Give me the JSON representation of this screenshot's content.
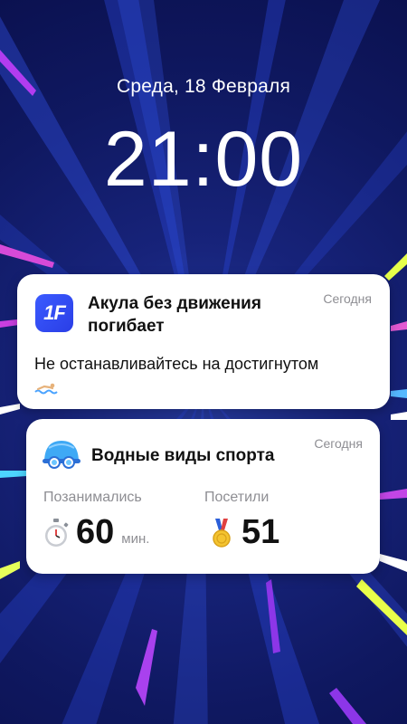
{
  "lockscreen": {
    "date": "Среда, 18 Февраля",
    "time": "21:00"
  },
  "notification": {
    "app_icon_text": "1F",
    "title": "Акула без движения погибает",
    "time": "Сегодня",
    "body": "Не останавливайтесь на достигнутом",
    "body_icon": "swimmer-icon",
    "accent_color": "#3346f0"
  },
  "widget": {
    "icon": "swim-cap-goggles-icon",
    "title": "Водные виды спорта",
    "time": "Сегодня",
    "stats": [
      {
        "label": "Позанимались",
        "icon": "stopwatch-icon",
        "value": "60",
        "unit": "мин."
      },
      {
        "label": "Посетили",
        "icon": "medal-icon",
        "value": "51",
        "unit": ""
      }
    ]
  },
  "colors": {
    "background": "#131c6b",
    "card": "#ffffff",
    "secondary_text": "#8e8e93"
  }
}
